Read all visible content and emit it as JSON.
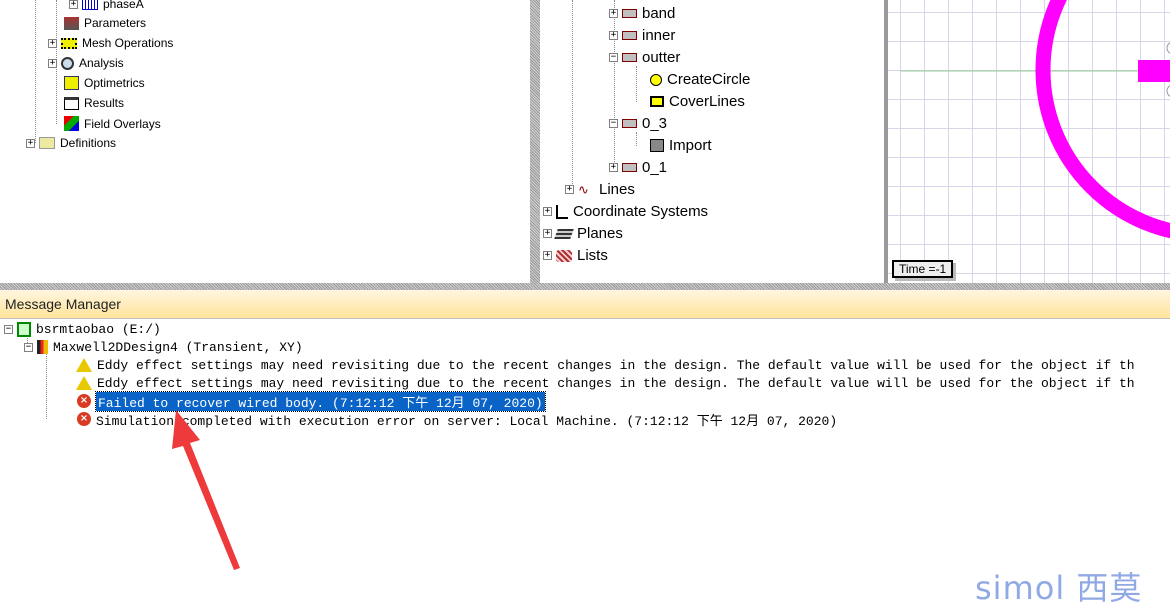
{
  "left_tree": {
    "items": [
      {
        "label": "phaseA",
        "icon": "winding-icon"
      },
      {
        "label": "Parameters",
        "icon": "parameters-icon"
      },
      {
        "label": "Mesh Operations",
        "icon": "mesh-icon"
      },
      {
        "label": "Analysis",
        "icon": "analysis-icon"
      },
      {
        "label": "Optimetrics",
        "icon": "optimetrics-icon"
      },
      {
        "label": "Results",
        "icon": "results-icon"
      },
      {
        "label": "Field Overlays",
        "icon": "field-overlays-icon"
      },
      {
        "label": "Definitions",
        "icon": "folder-icon"
      }
    ]
  },
  "model_tree": {
    "items": [
      {
        "label": "band"
      },
      {
        "label": "inner"
      },
      {
        "label": "outter"
      },
      {
        "label": "CreateCircle"
      },
      {
        "label": "CoverLines"
      },
      {
        "label": "0_3"
      },
      {
        "label": "Import"
      },
      {
        "label": "0_1"
      },
      {
        "label": "Lines"
      },
      {
        "label": "Coordinate Systems"
      },
      {
        "label": "Planes"
      },
      {
        "label": "Lists"
      }
    ]
  },
  "canvas": {
    "time_label": "Time =-1",
    "shape_color": "#ff00ff"
  },
  "message_manager": {
    "title": "Message Manager",
    "project": "bsrmtaobao (E:/)",
    "design": "Maxwell2DDesign4 (Transient, XY)",
    "messages": [
      {
        "type": "warning",
        "text": "Eddy effect settings may need revisiting due to the recent changes in the design.  The default value will be used for the object if th"
      },
      {
        "type": "warning",
        "text": "Eddy effect settings may need revisiting due to the recent changes in the design.  The default value will be used for the object if th"
      },
      {
        "type": "error",
        "text": "Failed to recover wired body. (7:12:12 下午  12月 07, 2020)",
        "selected": true
      },
      {
        "type": "error",
        "text": "Simulation completed with execution error on server: Local Machine. (7:12:12 下午  12月 07, 2020)"
      }
    ]
  },
  "watermark": "simol 西莫"
}
